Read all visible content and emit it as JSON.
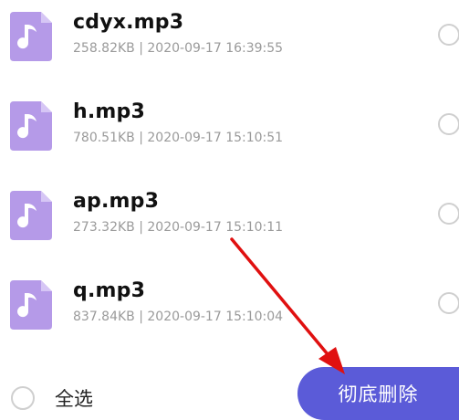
{
  "files": [
    {
      "name": "cdyx.mp3",
      "meta": "258.82KB | 2020-09-17 16:39:55"
    },
    {
      "name": "h.mp3",
      "meta": "780.51KB | 2020-09-17 15:10:51"
    },
    {
      "name": "ap.mp3",
      "meta": "273.32KB | 2020-09-17 15:10:11"
    },
    {
      "name": "q.mp3",
      "meta": "837.84KB | 2020-09-17 15:10:04"
    }
  ],
  "bottom_bar": {
    "select_all_label": "全选",
    "delete_label": "彻底删除"
  },
  "colors": {
    "icon": "#b59ae8",
    "button": "#5b5bd8",
    "arrow": "#e01010"
  },
  "icons": {
    "file": "music-file-icon",
    "arrow": "red-arrow-annotation"
  }
}
